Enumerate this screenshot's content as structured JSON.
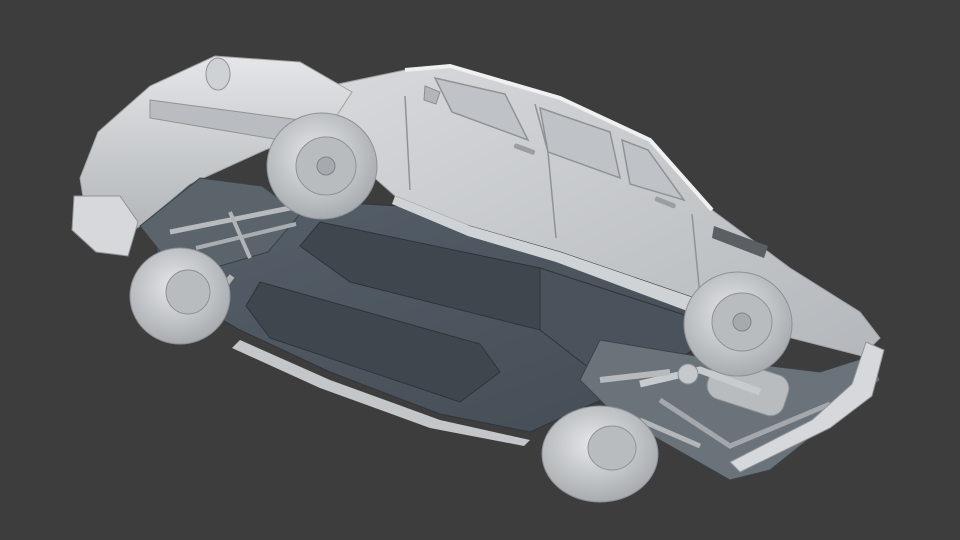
{
  "viewport": {
    "background_color": "#3d3d3d",
    "subject": "car-model-underside-clay-render"
  },
  "palette": {
    "body": "#c9cbce",
    "body_light": "#e2e4e6",
    "body_shadow": "#8e9296",
    "floor_pan": "#4b545b",
    "floor_pan_dark": "#3f474e",
    "tire": "#d4d6d8",
    "wheel_hub": "#b7babd",
    "chassis_part": "#a6aaae"
  }
}
